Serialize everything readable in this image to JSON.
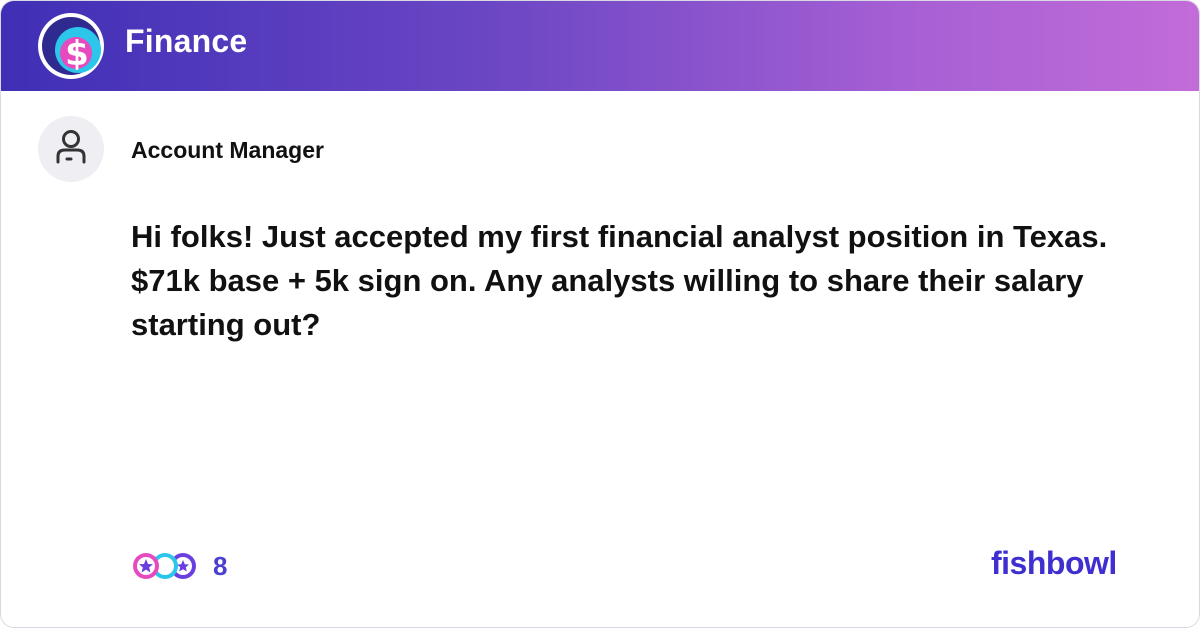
{
  "header": {
    "title": "Finance",
    "logo_icon": "dollar-bowl-icon",
    "gradient": [
      "#3f2fb6",
      "#c26cd8"
    ]
  },
  "post": {
    "author": "Account Manager",
    "avatar_icon": "person-icon",
    "text": "Hi folks! Just accepted my first financial analyst position in Texas. $71k base + 5k sign on. Any analysts willing to share their salary starting out?"
  },
  "reactions": {
    "icons": [
      "star-reaction-icon",
      "moon-reaction-icon",
      "star-outline-reaction-icon"
    ],
    "count": "8"
  },
  "brand": {
    "name": "fishbowl",
    "color": "#3f2fd0"
  }
}
